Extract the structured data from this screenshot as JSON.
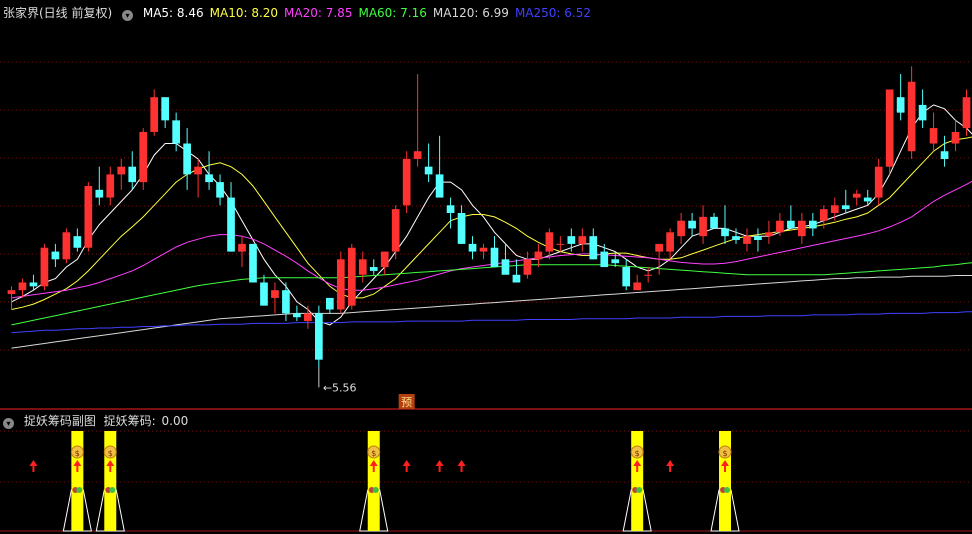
{
  "header": {
    "title": "张家界(日线 前复权)",
    "ma": [
      {
        "label": "MA5:",
        "value": "8.46",
        "color": "#ffffff"
      },
      {
        "label": "MA10:",
        "value": "8.20",
        "color": "#ffff40"
      },
      {
        "label": "MA20:",
        "value": "7.85",
        "color": "#ff40ff"
      },
      {
        "label": "MA60:",
        "value": "7.16",
        "color": "#40ff40"
      },
      {
        "label": "MA120:",
        "value": "6.99",
        "color": "#d8d8d8"
      },
      {
        "label": "MA250:",
        "value": "6.52",
        "color": "#4040ff"
      }
    ]
  },
  "sub": {
    "title": "捉妖筹码副图",
    "indicator_label": "捉妖筹码:",
    "indicator_value": "0.00"
  },
  "chart_data": {
    "type": "candlestick",
    "price_range": [
      5.3,
      10.3
    ],
    "low_annotation": "5.56",
    "forecast_marker": "预",
    "up_color": "#ff3232",
    "down_color": "#54ffff",
    "candles": [
      [
        6.75,
        6.85,
        6.55,
        6.8
      ],
      [
        6.8,
        6.95,
        6.7,
        6.9
      ],
      [
        6.9,
        7.0,
        6.8,
        6.85
      ],
      [
        6.85,
        7.4,
        6.8,
        7.35
      ],
      [
        7.3,
        7.4,
        7.1,
        7.2
      ],
      [
        7.2,
        7.6,
        7.15,
        7.55
      ],
      [
        7.5,
        7.6,
        7.3,
        7.35
      ],
      [
        7.35,
        8.2,
        7.3,
        8.15
      ],
      [
        8.1,
        8.4,
        7.9,
        8.0
      ],
      [
        8.0,
        8.4,
        7.9,
        8.3
      ],
      [
        8.3,
        8.5,
        8.1,
        8.4
      ],
      [
        8.4,
        8.6,
        8.1,
        8.2
      ],
      [
        8.2,
        8.9,
        8.1,
        8.85
      ],
      [
        8.85,
        9.4,
        8.8,
        9.3
      ],
      [
        9.3,
        9.3,
        8.9,
        9.0
      ],
      [
        9.0,
        9.1,
        8.6,
        8.7
      ],
      [
        8.7,
        8.9,
        8.1,
        8.3
      ],
      [
        8.3,
        8.5,
        8.0,
        8.4
      ],
      [
        8.3,
        8.6,
        8.1,
        8.2
      ],
      [
        8.2,
        8.3,
        7.9,
        8.0
      ],
      [
        8.0,
        8.2,
        7.3,
        7.3
      ],
      [
        7.3,
        7.5,
        7.1,
        7.4
      ],
      [
        7.4,
        7.4,
        6.9,
        6.9
      ],
      [
        6.9,
        7.0,
        6.6,
        6.6
      ],
      [
        6.7,
        6.9,
        6.5,
        6.8
      ],
      [
        6.8,
        6.9,
        6.4,
        6.5
      ],
      [
        6.5,
        6.6,
        6.4,
        6.45
      ],
      [
        6.4,
        6.6,
        6.3,
        6.5
      ],
      [
        6.5,
        6.6,
        5.8,
        5.9
      ],
      [
        6.7,
        6.7,
        6.5,
        6.55
      ],
      [
        6.55,
        7.3,
        6.5,
        7.2
      ],
      [
        6.6,
        7.4,
        6.55,
        7.35
      ],
      [
        7.0,
        7.3,
        6.9,
        7.2
      ],
      [
        7.1,
        7.2,
        7.0,
        7.05
      ],
      [
        7.1,
        7.3,
        7.0,
        7.3
      ],
      [
        7.3,
        7.9,
        7.2,
        7.85
      ],
      [
        7.9,
        8.6,
        7.8,
        8.5
      ],
      [
        8.5,
        9.6,
        8.4,
        8.6
      ],
      [
        8.4,
        8.7,
        8.2,
        8.3
      ],
      [
        8.3,
        8.8,
        8.1,
        8.0
      ],
      [
        7.9,
        8.0,
        7.6,
        7.8
      ],
      [
        7.8,
        7.9,
        7.4,
        7.4
      ],
      [
        7.4,
        7.5,
        7.2,
        7.3
      ],
      [
        7.3,
        7.4,
        7.2,
        7.35
      ],
      [
        7.35,
        7.5,
        7.1,
        7.1
      ],
      [
        7.2,
        7.4,
        7.1,
        7.0
      ],
      [
        7.0,
        7.2,
        6.9,
        6.9
      ],
      [
        7.0,
        7.3,
        6.95,
        7.2
      ],
      [
        7.2,
        7.4,
        7.1,
        7.3
      ],
      [
        7.3,
        7.6,
        7.2,
        7.55
      ],
      [
        7.4,
        7.5,
        7.3,
        7.4
      ],
      [
        7.5,
        7.6,
        7.3,
        7.4
      ],
      [
        7.4,
        7.6,
        7.3,
        7.5
      ],
      [
        7.5,
        7.6,
        7.2,
        7.2
      ],
      [
        7.3,
        7.4,
        7.1,
        7.1
      ],
      [
        7.2,
        7.3,
        7.1,
        7.15
      ],
      [
        7.1,
        7.2,
        6.8,
        6.85
      ],
      [
        6.8,
        7.0,
        6.8,
        6.9
      ],
      [
        7.0,
        7.1,
        6.9,
        7.0
      ],
      [
        7.3,
        7.4,
        7.0,
        7.4
      ],
      [
        7.3,
        7.6,
        7.2,
        7.55
      ],
      [
        7.5,
        7.8,
        7.4,
        7.7
      ],
      [
        7.7,
        7.8,
        7.5,
        7.6
      ],
      [
        7.5,
        7.9,
        7.4,
        7.75
      ],
      [
        7.75,
        7.8,
        7.6,
        7.6
      ],
      [
        7.6,
        7.9,
        7.4,
        7.5
      ],
      [
        7.5,
        7.6,
        7.4,
        7.45
      ],
      [
        7.4,
        7.6,
        7.3,
        7.5
      ],
      [
        7.5,
        7.6,
        7.3,
        7.45
      ],
      [
        7.5,
        7.7,
        7.4,
        7.55
      ],
      [
        7.55,
        7.8,
        7.5,
        7.7
      ],
      [
        7.7,
        7.9,
        7.6,
        7.6
      ],
      [
        7.5,
        7.8,
        7.4,
        7.7
      ],
      [
        7.7,
        7.8,
        7.5,
        7.6
      ],
      [
        7.7,
        7.9,
        7.6,
        7.85
      ],
      [
        7.8,
        8.0,
        7.7,
        7.9
      ],
      [
        7.9,
        8.1,
        7.8,
        7.85
      ],
      [
        8.0,
        8.1,
        7.9,
        8.05
      ],
      [
        8.0,
        8.1,
        7.9,
        7.95
      ],
      [
        8.0,
        8.5,
        7.9,
        8.4
      ],
      [
        8.4,
        9.4,
        8.3,
        9.4
      ],
      [
        9.3,
        9.6,
        9.0,
        9.1
      ],
      [
        8.6,
        9.7,
        8.5,
        9.5
      ],
      [
        9.2,
        9.4,
        8.9,
        9.0
      ],
      [
        8.7,
        9.1,
        8.6,
        8.9
      ],
      [
        8.6,
        8.8,
        8.4,
        8.5
      ],
      [
        8.7,
        9.0,
        8.6,
        8.85
      ],
      [
        8.9,
        9.4,
        8.8,
        9.3
      ]
    ],
    "ma_values": [
      [
        6.65,
        6.72,
        6.8,
        6.9,
        6.95,
        7.1,
        7.2,
        7.45,
        7.65,
        7.8,
        7.95,
        8.1,
        8.3,
        8.55,
        8.7,
        8.7,
        8.6,
        8.5,
        8.3,
        8.15,
        7.95,
        7.7,
        7.45,
        7.2,
        7.0,
        6.85,
        6.65,
        6.55,
        6.4,
        6.35,
        6.45,
        6.65,
        6.8,
        6.95,
        7.1,
        7.3,
        7.5,
        7.75,
        8.0,
        8.2,
        8.2,
        8.1,
        7.9,
        7.75,
        7.55,
        7.4,
        7.25,
        7.2,
        7.2,
        7.25,
        7.3,
        7.35,
        7.4,
        7.4,
        7.35,
        7.3,
        7.2,
        7.1,
        7.05,
        7.1,
        7.2,
        7.35,
        7.5,
        7.55,
        7.6,
        7.6,
        7.55,
        7.5,
        7.5,
        7.5,
        7.55,
        7.6,
        7.62,
        7.65,
        7.7,
        7.75,
        7.8,
        7.85,
        7.9,
        8.05,
        8.3,
        8.6,
        8.9,
        9.1,
        9.2,
        9.15,
        9.0,
        8.9,
        8.75
      ],
      [
        6.55,
        6.58,
        6.62,
        6.68,
        6.75,
        6.82,
        6.92,
        7.05,
        7.2,
        7.35,
        7.5,
        7.62,
        7.75,
        7.9,
        8.05,
        8.2,
        8.3,
        8.37,
        8.42,
        8.45,
        8.4,
        8.3,
        8.15,
        7.95,
        7.75,
        7.55,
        7.35,
        7.15,
        7.0,
        6.85,
        6.75,
        6.7,
        6.7,
        6.75,
        6.85,
        6.95,
        7.1,
        7.25,
        7.4,
        7.55,
        7.7,
        7.75,
        7.78,
        7.78,
        7.75,
        7.68,
        7.6,
        7.5,
        7.42,
        7.35,
        7.3,
        7.27,
        7.25,
        7.25,
        7.27,
        7.28,
        7.28,
        7.25,
        7.22,
        7.2,
        7.2,
        7.22,
        7.27,
        7.32,
        7.37,
        7.42,
        7.47,
        7.5,
        7.52,
        7.54,
        7.56,
        7.58,
        7.6,
        7.62,
        7.65,
        7.68,
        7.72,
        7.75,
        7.8,
        7.9,
        8.0,
        8.15,
        8.3,
        8.45,
        8.6,
        8.7,
        8.75,
        8.77,
        8.8
      ],
      [
        6.7,
        6.72,
        6.74,
        6.76,
        6.78,
        6.8,
        6.83,
        6.86,
        6.9,
        6.95,
        7.0,
        7.05,
        7.12,
        7.2,
        7.28,
        7.36,
        7.42,
        7.46,
        7.5,
        7.52,
        7.52,
        7.5,
        7.46,
        7.4,
        7.32,
        7.24,
        7.15,
        7.05,
        6.96,
        6.88,
        6.82,
        6.8,
        6.8,
        6.82,
        6.84,
        6.87,
        6.9,
        6.93,
        6.97,
        7.01,
        7.05,
        7.08,
        7.1,
        7.12,
        7.14,
        7.16,
        7.18,
        7.2,
        7.22,
        7.23,
        7.25,
        7.26,
        7.27,
        7.27,
        7.26,
        7.25,
        7.24,
        7.23,
        7.22,
        7.2,
        7.18,
        7.16,
        7.15,
        7.14,
        7.14,
        7.15,
        7.17,
        7.2,
        7.23,
        7.26,
        7.29,
        7.32,
        7.35,
        7.38,
        7.41,
        7.44,
        7.47,
        7.5,
        7.53,
        7.57,
        7.62,
        7.68,
        7.75,
        7.85,
        7.95,
        8.03,
        8.1,
        8.17,
        8.25
      ],
      [
        6.35,
        6.38,
        6.41,
        6.44,
        6.47,
        6.5,
        6.53,
        6.56,
        6.59,
        6.62,
        6.65,
        6.68,
        6.71,
        6.74,
        6.77,
        6.8,
        6.83,
        6.86,
        6.88,
        6.9,
        6.92,
        6.94,
        6.95,
        6.96,
        6.96,
        6.96,
        6.96,
        6.96,
        6.96,
        6.96,
        6.96,
        6.97,
        6.98,
        6.99,
        7.0,
        7.01,
        7.02,
        7.03,
        7.04,
        7.05,
        7.06,
        7.07,
        7.08,
        7.09,
        7.1,
        7.11,
        7.12,
        7.13,
        7.13,
        7.13,
        7.13,
        7.13,
        7.13,
        7.13,
        7.13,
        7.12,
        7.11,
        7.1,
        7.09,
        7.08,
        7.07,
        7.06,
        7.05,
        7.04,
        7.03,
        7.02,
        7.01,
        7.0,
        7.0,
        7.0,
        7.0,
        7.0,
        7.0,
        7.0,
        7.0,
        7.01,
        7.02,
        7.03,
        7.04,
        7.05,
        7.06,
        7.07,
        7.08,
        7.09,
        7.1,
        7.12,
        7.13,
        7.15,
        7.16
      ],
      [
        6.05,
        6.07,
        6.09,
        6.11,
        6.13,
        6.15,
        6.17,
        6.19,
        6.21,
        6.23,
        6.25,
        6.27,
        6.29,
        6.31,
        6.33,
        6.35,
        6.37,
        6.39,
        6.41,
        6.43,
        6.44,
        6.45,
        6.46,
        6.47,
        6.48,
        6.49,
        6.5,
        6.5,
        6.5,
        6.5,
        6.5,
        6.51,
        6.52,
        6.53,
        6.54,
        6.55,
        6.56,
        6.57,
        6.58,
        6.59,
        6.6,
        6.61,
        6.62,
        6.63,
        6.64,
        6.65,
        6.66,
        6.67,
        6.68,
        6.69,
        6.7,
        6.71,
        6.72,
        6.73,
        6.74,
        6.75,
        6.76,
        6.77,
        6.78,
        6.79,
        6.8,
        6.81,
        6.82,
        6.83,
        6.84,
        6.85,
        6.86,
        6.87,
        6.88,
        6.89,
        6.9,
        6.91,
        6.92,
        6.93,
        6.94,
        6.95,
        6.95,
        6.96,
        6.96,
        6.97,
        6.97,
        6.97,
        6.98,
        6.98,
        6.98,
        6.98,
        6.99,
        6.99,
        6.99
      ],
      [
        6.25,
        6.26,
        6.27,
        6.28,
        6.28,
        6.29,
        6.3,
        6.3,
        6.31,
        6.31,
        6.32,
        6.32,
        6.33,
        6.33,
        6.34,
        6.34,
        6.35,
        6.35,
        6.35,
        6.36,
        6.36,
        6.36,
        6.37,
        6.37,
        6.37,
        6.37,
        6.38,
        6.38,
        6.38,
        6.38,
        6.38,
        6.39,
        6.39,
        6.39,
        6.39,
        6.39,
        6.4,
        6.4,
        6.4,
        6.4,
        6.4,
        6.4,
        6.41,
        6.41,
        6.41,
        6.41,
        6.41,
        6.42,
        6.42,
        6.42,
        6.42,
        6.42,
        6.43,
        6.43,
        6.43,
        6.43,
        6.43,
        6.44,
        6.44,
        6.44,
        6.44,
        6.45,
        6.45,
        6.45,
        6.45,
        6.46,
        6.46,
        6.46,
        6.46,
        6.47,
        6.47,
        6.47,
        6.47,
        6.48,
        6.48,
        6.48,
        6.48,
        6.49,
        6.49,
        6.49,
        6.5,
        6.5,
        6.5,
        6.5,
        6.51,
        6.51,
        6.51,
        6.52,
        6.52
      ]
    ],
    "signal_columns": [
      6,
      9,
      33,
      57,
      65
    ],
    "arrow_columns": [
      2,
      6,
      9,
      33,
      36,
      39,
      41,
      57,
      60,
      65
    ]
  }
}
